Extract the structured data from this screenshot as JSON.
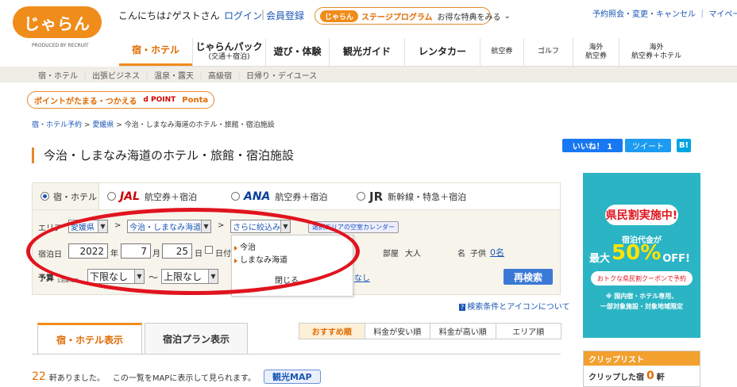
{
  "header": {
    "logo": "じゃらん",
    "logo_sub": "PRODUCED BY RECRUIT",
    "greeting": "こんにちは♪ゲストさん",
    "login": "ログイン",
    "sep": "|",
    "register": "会員登録",
    "stage_badge": "じゃらん",
    "stage_program": "ステージプログラム",
    "stage_benefit": "お得な特典をみる",
    "stage_chevron": "⌄",
    "top_links": "予約照会・変更・キャンセル ｜ マイページ"
  },
  "nav": {
    "items": [
      {
        "label": "宿・ホテル",
        "sub": ""
      },
      {
        "label": "じゃらんパック",
        "sub": "(交通＋宿泊)"
      },
      {
        "label": "遊び・体験",
        "sub": ""
      },
      {
        "label": "観光ガイド",
        "sub": ""
      },
      {
        "label": "レンタカー",
        "sub": ""
      },
      {
        "label": "航空券",
        "sub": ""
      },
      {
        "label": "ゴルフ",
        "sub": ""
      },
      {
        "label": "海外",
        "sub": "航空券"
      },
      {
        "label": "海外",
        "sub": "航空券＋ホテル"
      }
    ]
  },
  "subnav": {
    "items": [
      "宿・ホテル",
      "出張ビジネス",
      "温泉・露天",
      "高級宿",
      "日帰り・デイユース"
    ],
    "sep": "｜"
  },
  "points": {
    "label": "ポイントがたまる・つかえる",
    "dpoint": "d POINT",
    "ponta": "Ponta"
  },
  "breadcrumb": {
    "items": [
      "宿・ホテル予約",
      "愛媛県",
      "今治・しまなみ海道のホテル・旅館・宿泊施設"
    ],
    "sep": ">"
  },
  "page_title": "今治・しまなみ海道のホテル・旅館・宿泊施設",
  "social": {
    "like": "いいね！ 1",
    "tweet": "ツイート",
    "hatena": "B!"
  },
  "search": {
    "tabs": [
      {
        "logo": "",
        "label": "宿・ホテル"
      },
      {
        "logo": "JAL",
        "label": "航空券＋宿泊"
      },
      {
        "logo": "ANA",
        "label": "航空券＋宿泊"
      },
      {
        "logo": "JR",
        "label": "新幹線・特急＋宿泊"
      }
    ],
    "area_label": "エリア",
    "pref": "愛媛県",
    "arrow": ">",
    "area": "今治・しまなみ海道",
    "narrow": "さらに絞込み",
    "calendar_btn": "選択エリアの空室カレンダー",
    "checkin_label": "宿泊日",
    "year": "2022",
    "year_unit": "年",
    "month": "7",
    "month_unit": "月",
    "day": "25",
    "day_unit": "日",
    "undecided": "日付",
    "rooms_label": "部屋",
    "adults_label": "大人",
    "name_label": "名",
    "children_label": "子供",
    "children_value": "0名",
    "budget_label": "予算",
    "budget_sub": "1泊あたり",
    "min_budget": "下限なし",
    "tilde": "〜",
    "max_budget": "上限なし",
    "nashi": "なし",
    "submit": "再検索",
    "dropdown_arrow": "▼",
    "popup_items": [
      "今治",
      "しまなみ海道"
    ],
    "popup_close": "閉じる",
    "help_link": "検索条件とアイコンについて",
    "help_icon": "?"
  },
  "results": {
    "tab_hotels": "宿・ホテル表示",
    "tab_plans": "宿泊プラン表示",
    "sort": [
      "おすすめ順",
      "料金が安い順",
      "料金が高い順",
      "エリア順"
    ],
    "count": "22",
    "count_suffix": "軒ありました。",
    "map_text": "この一覧をMAPに表示して見られます。",
    "map_btn": "観光MAP"
  },
  "ad": {
    "header": "県民割実施中!",
    "line1": "宿泊代金が",
    "max": "最大",
    "big": "50%",
    "off": "OFF!",
    "coupon": "おトクな県民割クーポンで予約",
    "note1": "※ 国内宿・ホテル専用、",
    "note2": "一部対象施設・対象地域限定",
    "color": "#2bb5c4"
  },
  "clip": {
    "title": "クリップリスト",
    "label": "クリップした宿",
    "count": "0",
    "unit": "軒"
  },
  "colors": {
    "brand": "#f08c1a",
    "link": "#1a55b5",
    "ring": "#e0141e"
  }
}
